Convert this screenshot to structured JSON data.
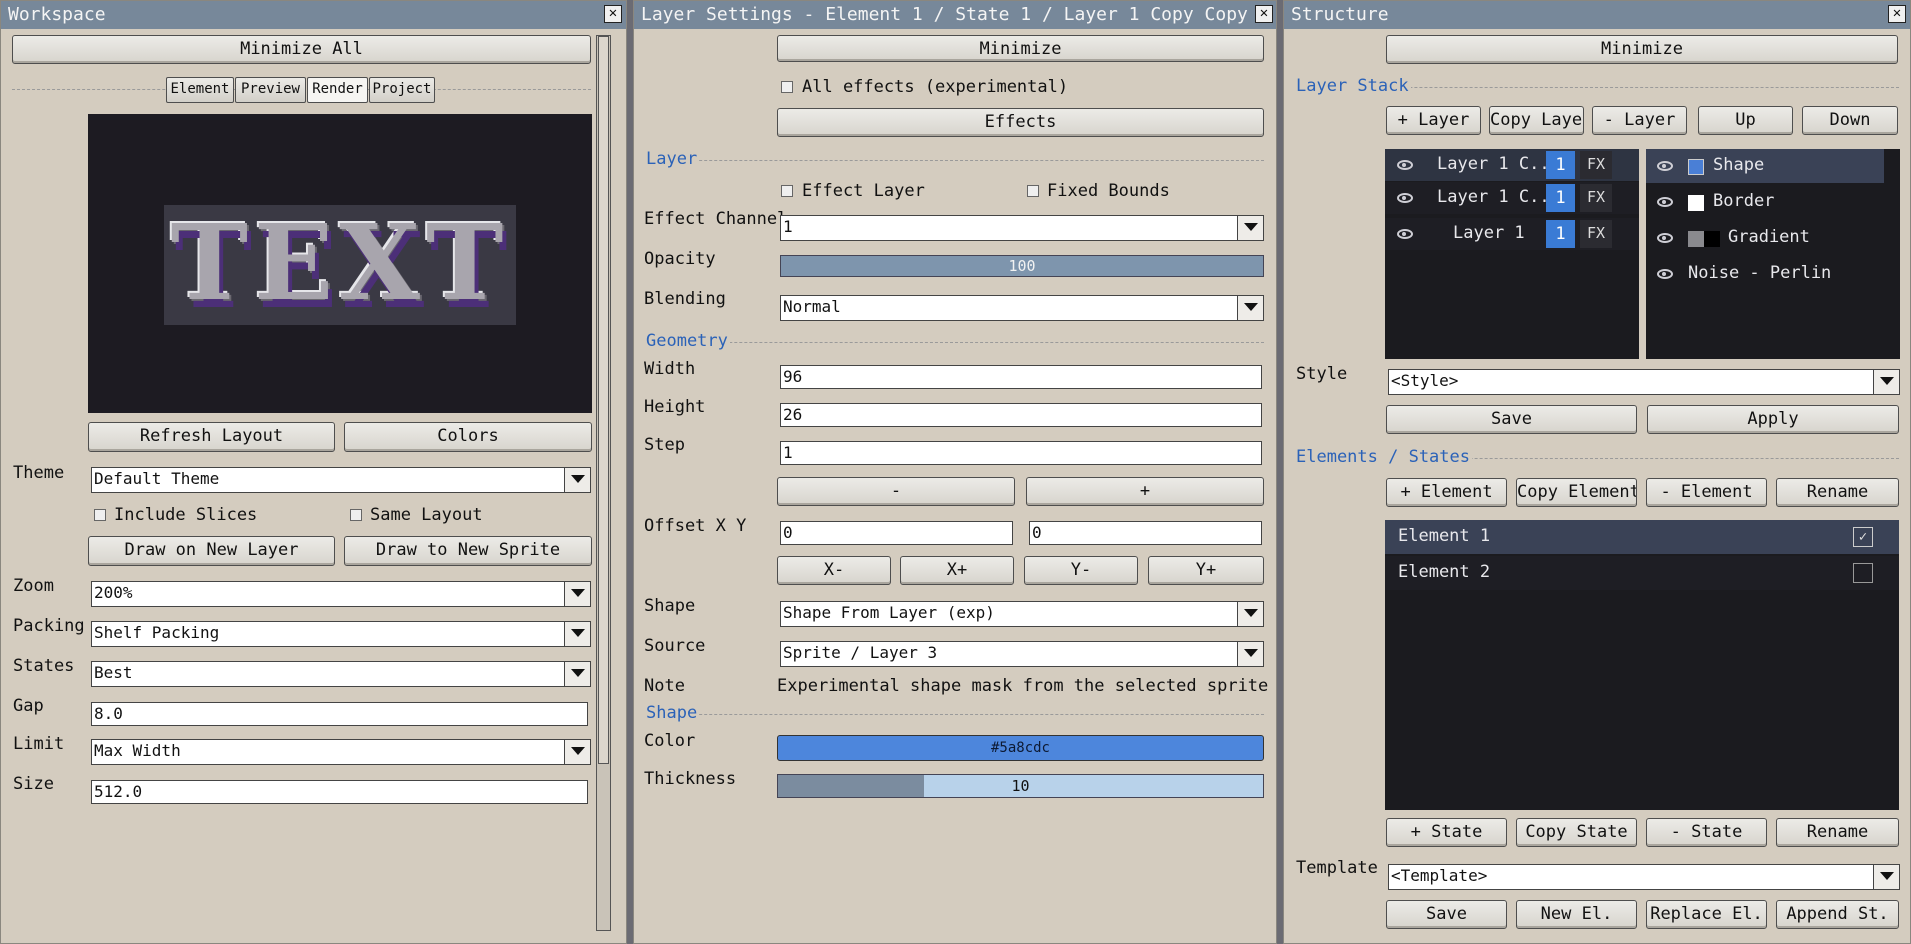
{
  "workspace": {
    "title": "Workspace",
    "minimize_all": "Minimize All",
    "tabs": [
      "Element",
      "Preview",
      "Render",
      "Project"
    ],
    "preview_text": "TEXT",
    "refresh_layout": "Refresh Layout",
    "colors": "Colors",
    "theme_label": "Theme",
    "theme_value": "Default Theme",
    "include_slices": "Include Slices",
    "same_layout": "Same Layout",
    "draw_new_layer": "Draw on New Layer",
    "draw_new_sprite": "Draw to New Sprite",
    "zoom_label": "Zoom",
    "zoom_value": "200%",
    "packing_label": "Packing",
    "packing_value": "Shelf Packing",
    "states_label": "States",
    "states_value": "Best",
    "gap_label": "Gap",
    "gap_value": "8.0",
    "limit_label": "Limit",
    "limit_value": "Max Width",
    "size_label": "Size",
    "size_value": "512.0"
  },
  "layer_settings": {
    "title": "Layer Settings - Element 1 / State 1 / Layer 1 Copy Copy",
    "minimize": "Minimize",
    "all_effects": "All effects (experimental)",
    "effects": "Effects",
    "layer_section": "Layer",
    "effect_layer": "Effect Layer",
    "fixed_bounds": "Fixed Bounds",
    "effect_channel_label": "Effect Channel",
    "effect_channel_value": "1",
    "opacity_label": "Opacity",
    "opacity_value": "100",
    "blending_label": "Blending",
    "blending_value": "Normal",
    "geometry_section": "Geometry",
    "width_label": "Width",
    "width_value": "96",
    "height_label": "Height",
    "height_value": "26",
    "step_label": "Step",
    "step_value": "1",
    "minus": "-",
    "plus": "+",
    "offset_label": "Offset X Y",
    "offset_x": "0",
    "offset_y": "0",
    "x_minus": "X-",
    "x_plus": "X+",
    "y_minus": "Y-",
    "y_plus": "Y+",
    "shape_label": "Shape",
    "shape_value": "Shape From Layer (exp)",
    "source_label": "Source",
    "source_value": "Sprite / Layer 3",
    "note_label": "Note",
    "note_value": "Experimental shape mask from the selected sprite layer.",
    "shape_section": "Shape",
    "color_label": "Color",
    "color_value": "#5a8cdc",
    "thickness_label": "Thickness",
    "thickness_value": "10",
    "thickness_fraction": 0.3
  },
  "structure": {
    "title": "Structure",
    "minimize": "Minimize",
    "layer_stack_section": "Layer Stack",
    "add_layer": "+ Layer",
    "copy_layer": "Copy Layer",
    "remove_layer": "- Layer",
    "up": "Up",
    "down": "Down",
    "layers": [
      {
        "name": "Layer 1 C...",
        "channel": "1",
        "fx": "FX"
      },
      {
        "name": "Layer 1 C...",
        "channel": "1",
        "fx": "FX"
      },
      {
        "name": "Layer 1",
        "channel": "1",
        "fx": "FX"
      }
    ],
    "effects": [
      {
        "name": "Shape",
        "swatch": "#4a7fd6"
      },
      {
        "name": "Border",
        "swatch": "#ffffff"
      },
      {
        "name": "Gradient",
        "swatch": "#888888"
      },
      {
        "name": "Noise - Perlin",
        "swatch": ""
      }
    ],
    "style_label": "Style",
    "style_value": "<Style>",
    "save": "Save",
    "apply": "Apply",
    "elements_section": "Elements / States",
    "add_element": "+ Element",
    "copy_element": "Copy Element",
    "remove_element": "- Element",
    "rename": "Rename",
    "elements": [
      "Element 1",
      "Element 2"
    ],
    "add_state": "+ State",
    "copy_state": "Copy State",
    "remove_state": "- State",
    "rename_state": "Rename",
    "template_label": "Template",
    "template_value": "<Template>",
    "save_template": "Save",
    "new_el": "New El.",
    "replace_el": "Replace El.",
    "append_st": "Append St."
  },
  "colors": {
    "accent": "#2b62b8",
    "titlebar": "#77889a",
    "panel_bg": "#d4ccbf",
    "shape_color": "#5a8cdc",
    "selected_row": "#3a4256"
  }
}
